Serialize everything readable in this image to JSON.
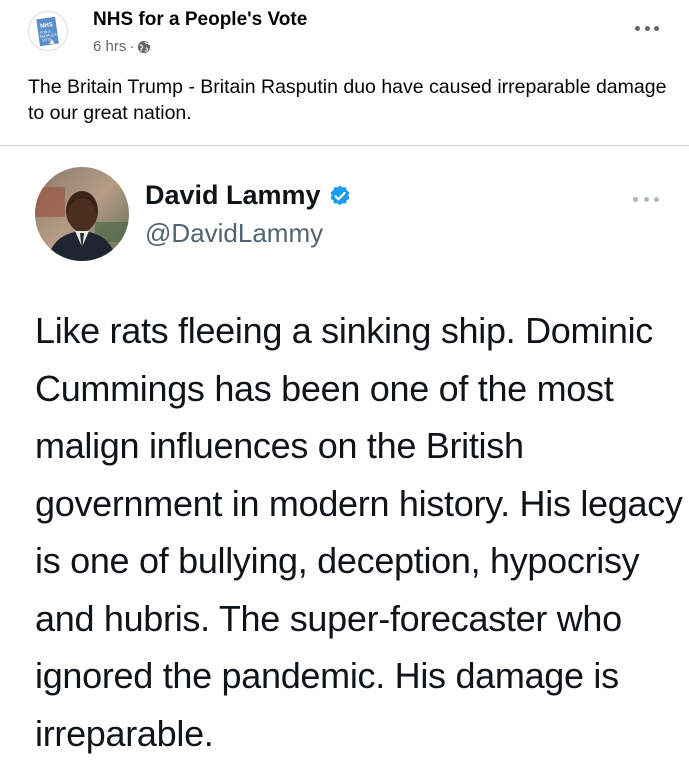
{
  "post": {
    "page_name": "NHS for a People's Vote",
    "timestamp": "6 hrs",
    "separator": "·",
    "privacy_icon": "globe-icon",
    "more_icon": "more-options-icon",
    "text": "The Britain Trump - Britain Rasputin duo have caused irreparable damage to our great nation.",
    "avatar_text": [
      "NHS",
      "FOR A",
      "PEOPLE'S",
      "VOTE"
    ]
  },
  "tweet": {
    "name": "David Lammy",
    "handle": "@DavidLammy",
    "verified_icon": "verified-badge-icon",
    "more_icon": "more-options-icon",
    "text": "Like rats fleeing a sinking ship. Dominic Cummings has been one of the most malign influences on the British government in modern history. His legacy is one of bullying, deception, hypocrisy and hubris. The super-forecaster who ignored the pandemic. His damage is irreparable."
  },
  "colors": {
    "name_text": "#050505",
    "meta_text": "#65676b",
    "verified_blue": "#1d9bf0",
    "handle_grey": "#536471",
    "divider": "#ced0d4"
  }
}
